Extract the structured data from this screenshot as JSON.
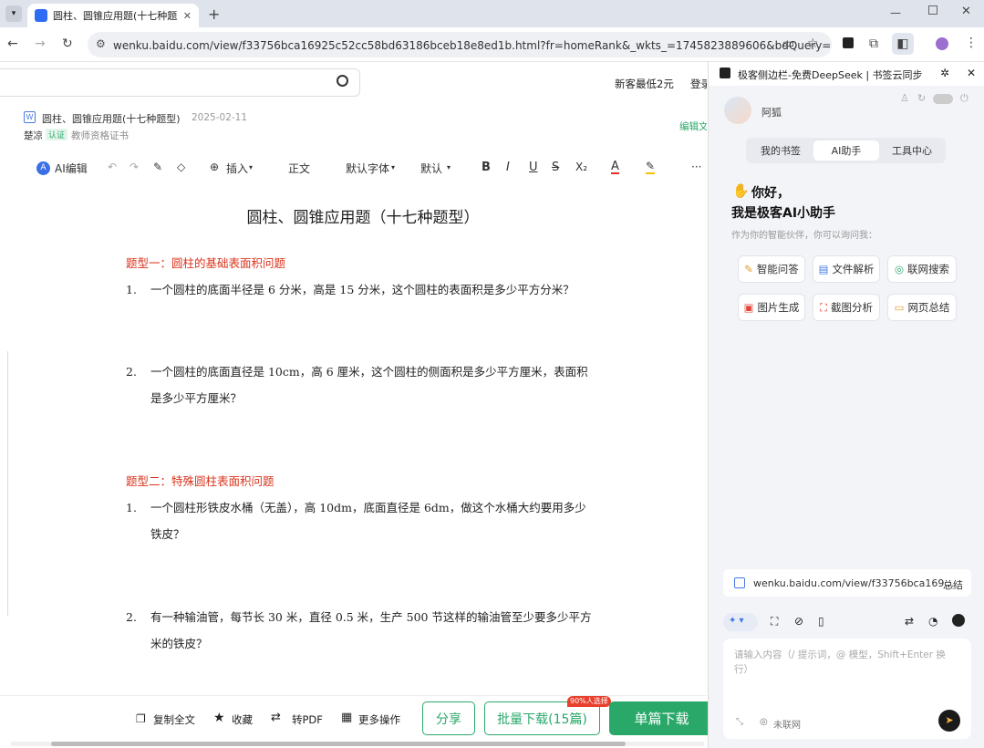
{
  "browser": {
    "tab_title": "圆柱、圆锥应用题(十七种题型)",
    "url": "wenku.baidu.com/view/f33756bca16925c52cc58bd63186bceb18e8ed1b.html?fr=homeRank&_wkts_=1745823889606&bdQuery=百..."
  },
  "header": {
    "promo": "新客最低2元",
    "login": "登录"
  },
  "doc_meta": {
    "title": "圆柱、圆锥应用题(十七种题型)",
    "date": "2025-02-11",
    "author": "楚凉",
    "badge": "认证",
    "cert": "教师资格证书",
    "edit_link": "编辑文"
  },
  "editor": {
    "ai": "AI编辑",
    "insert": "插入",
    "style": "正文",
    "font": "默认字体",
    "size": "默认"
  },
  "document": {
    "title": "圆柱、圆锥应用题（十七种题型）",
    "sections": [
      {
        "heading": "题型一：圆柱的基础表面积问题",
        "items": [
          {
            "num": "1.",
            "lines": [
              "一个圆柱的底面半径是 6 分米，高是 15 分米，这个圆柱的表面积是多少平方分米？"
            ]
          },
          {
            "num": "2.",
            "lines": [
              "一个圆柱的底面直径是 10cm，高 6 厘米，这个圆柱的侧面积是多少平方厘米，表面积",
              "是多少平方厘米？"
            ]
          }
        ]
      },
      {
        "heading": "题型二：特殊圆柱表面积问题",
        "items": [
          {
            "num": "1.",
            "lines": [
              "一个圆柱形铁皮水桶（无盖），高 10dm，底面直径是 6dm，做这个水桶大约要用多少",
              "铁皮？"
            ]
          },
          {
            "num": "2.",
            "lines": [
              "有一种输油管，每节长 30 米，直径 0.5 米，生产 500 节这样的输油管至少要多少平方",
              "米的铁皮？"
            ]
          }
        ]
      }
    ]
  },
  "bottom_bar": {
    "copy": "复制全文",
    "fav": "收藏",
    "pdf": "转PDF",
    "more": "更多操作",
    "share": "分享",
    "batch": "批量下载(15篇)",
    "batch_badge": "90%人选择",
    "single": "单篇下载"
  },
  "panel": {
    "title": "极客侧边栏-免费DeepSeek | 书签云同步",
    "user": "阿狐",
    "tabs": [
      "我的书签",
      "AI助手",
      "工具中心"
    ],
    "greet1": "你好，",
    "greet2": "我是极客AI小助手",
    "subtitle": "作为你的智能伙伴，你可以询问我：",
    "chips": [
      {
        "label": "智能问答",
        "icon": "pen-icon",
        "color": "#e69a2e"
      },
      {
        "label": "文件解析",
        "icon": "file-icon",
        "color": "#3b73e0"
      },
      {
        "label": "联网搜索",
        "icon": "globe-icon",
        "color": "#2aa86a"
      },
      {
        "label": "图片生成",
        "icon": "image-icon",
        "color": "#e0463b"
      },
      {
        "label": "截图分析",
        "icon": "crop-icon",
        "color": "#e0463b"
      },
      {
        "label": "网页总结",
        "icon": "page-icon",
        "color": "#e69a2e"
      }
    ],
    "page_url": "wenku.baidu.com/view/f33756bca169...",
    "summarize": "总结",
    "input_placeholder": "请输入内容（/ 提示词，@ 模型，Shift+Enter 换行）",
    "net_status": "未联网"
  }
}
